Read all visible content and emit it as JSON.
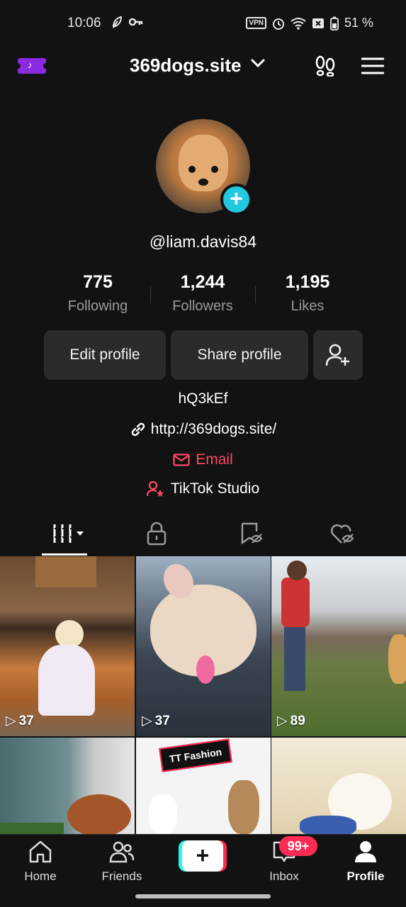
{
  "status_bar": {
    "time": "10:06",
    "vpn_label": "VPN",
    "battery": "51 %",
    "icons": [
      "leaf-icon",
      "key-icon",
      "vpn-icon",
      "alarm-icon",
      "wifi-icon",
      "sim-off-icon",
      "battery-icon"
    ]
  },
  "header": {
    "title": "369dogs.site",
    "icons": [
      "tiktok-ticket-icon",
      "chevron-down-icon",
      "footprints-icon",
      "menu-icon"
    ]
  },
  "profile": {
    "username": "@liam.davis84",
    "stats": [
      {
        "value": "775",
        "label": "Following"
      },
      {
        "value": "1,244",
        "label": "Followers"
      },
      {
        "value": "1,195",
        "label": "Likes"
      }
    ],
    "buttons": {
      "edit": "Edit profile",
      "share": "Share profile"
    },
    "bio": "hQ3kEf",
    "link": "http://369dogs.site/",
    "email": "Email",
    "studio": "TikTok Studio"
  },
  "tabs": [
    "videos-tab",
    "private-tab",
    "reposts-tab",
    "liked-tab"
  ],
  "videos": [
    {
      "views": "37"
    },
    {
      "views": "37"
    },
    {
      "views": "89"
    },
    {
      "views": ""
    },
    {
      "views": "",
      "overlay_text": "TT Fashion"
    },
    {
      "views": ""
    }
  ],
  "bottom_nav": {
    "home": "Home",
    "friends": "Friends",
    "inbox": "Inbox",
    "inbox_badge": "99+",
    "profile": "Profile"
  },
  "colors": {
    "background": "#121212",
    "accent_red": "#fe2c55",
    "accent_cyan": "#25f4ee",
    "email_red": "#fe4a64"
  }
}
